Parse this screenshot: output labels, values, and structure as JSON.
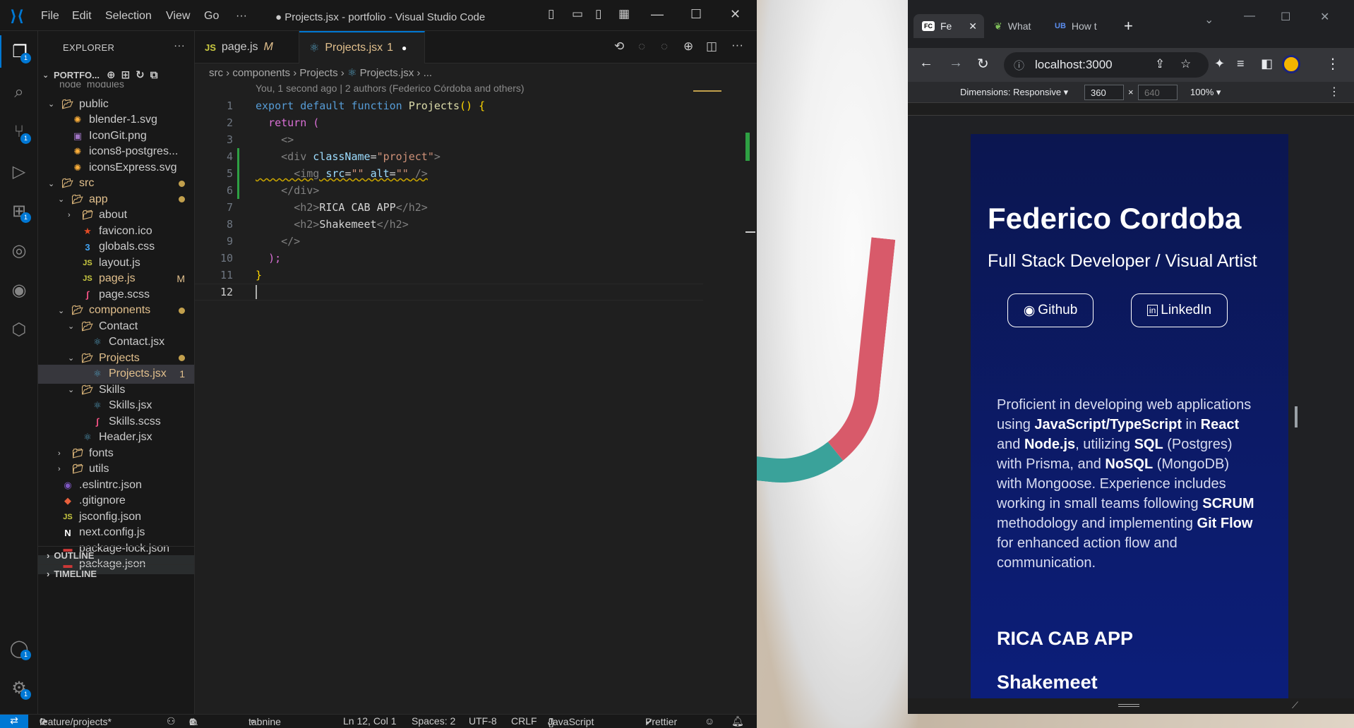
{
  "vscode": {
    "title": "● Projects.jsx - portfolio - Visual Studio Code",
    "menu": [
      "File",
      "Edit",
      "Selection",
      "View",
      "Go",
      "···"
    ],
    "explorer_title": "EXPLORER",
    "explorer_more": "···",
    "project_name": "PORTFO...",
    "partial_top": "node_modules",
    "tree": [
      {
        "label": "public",
        "type": "folder-open",
        "depth": 1
      },
      {
        "label": "blender-1.svg",
        "type": "svg",
        "depth": 2
      },
      {
        "label": "IconGit.png",
        "type": "png",
        "depth": 2
      },
      {
        "label": "icons8-postgres...",
        "type": "svg",
        "depth": 2
      },
      {
        "label": "iconsExpress.svg",
        "type": "svg",
        "depth": 2
      },
      {
        "label": "src",
        "type": "folder-open",
        "depth": 1,
        "dot": true
      },
      {
        "label": "app",
        "type": "folder-open",
        "depth": 2,
        "dot": true
      },
      {
        "label": "about",
        "type": "folder-closed",
        "depth": 3
      },
      {
        "label": "favicon.ico",
        "type": "ico",
        "depth": 3
      },
      {
        "label": "globals.css",
        "type": "css",
        "depth": 3
      },
      {
        "label": "layout.js",
        "type": "js",
        "depth": 3
      },
      {
        "label": "page.js",
        "type": "js",
        "depth": 3,
        "status": "M"
      },
      {
        "label": "page.scss",
        "type": "scss",
        "depth": 3
      },
      {
        "label": "components",
        "type": "folder-open",
        "depth": 2,
        "dot": true
      },
      {
        "label": "Contact",
        "type": "folder-open",
        "depth": 3
      },
      {
        "label": "Contact.jsx",
        "type": "react",
        "depth": 4
      },
      {
        "label": "Projects",
        "type": "folder-open",
        "depth": 3,
        "dot": true
      },
      {
        "label": "Projects.jsx",
        "type": "react",
        "depth": 4,
        "status": "1",
        "selected": true
      },
      {
        "label": "Skills",
        "type": "folder-open",
        "depth": 3
      },
      {
        "label": "Skills.jsx",
        "type": "react",
        "depth": 4
      },
      {
        "label": "Skills.scss",
        "type": "scss",
        "depth": 4
      },
      {
        "label": "Header.jsx",
        "type": "react",
        "depth": 3
      },
      {
        "label": "fonts",
        "type": "folder-closed",
        "depth": 2
      },
      {
        "label": "utils",
        "type": "folder-closed",
        "depth": 2
      },
      {
        "label": ".eslintrc.json",
        "type": "eslint",
        "depth": 1
      },
      {
        "label": ".gitignore",
        "type": "git",
        "depth": 1
      },
      {
        "label": "jsconfig.json",
        "type": "js",
        "depth": 1
      },
      {
        "label": "next.config.js",
        "type": "next",
        "depth": 1
      },
      {
        "label": "package-lock.json",
        "type": "npm",
        "depth": 1
      },
      {
        "label": "package.json",
        "type": "npm",
        "depth": 1,
        "hover": true
      }
    ],
    "outline_label": "OUTLINE",
    "timeline_label": "TIMELINE",
    "tabs": [
      {
        "label": "page.js",
        "prefix": "JS",
        "status": "M"
      },
      {
        "label": "Projects.jsx",
        "status": "1"
      }
    ],
    "breadcrumb": [
      "src",
      "components",
      "Projects",
      "Projects.jsx",
      "..."
    ],
    "blame": "You, 1 second ago | 2 authors (Federico Córdoba and others)",
    "line_numbers": [
      "1",
      "2",
      "3",
      "4",
      "5",
      "6",
      "7",
      "8",
      "9",
      "10",
      "11",
      "12"
    ],
    "code": {
      "l1": [
        "export",
        "default",
        "function",
        "Projects",
        "() {"
      ],
      "l2": [
        "return",
        "("
      ],
      "l3": "<>",
      "l4": [
        "<div",
        "className",
        "=",
        "\"project\"",
        ">"
      ],
      "l5": [
        "<img",
        "src",
        "=",
        "\"\"",
        "alt",
        "=",
        "\"\"",
        "/>"
      ],
      "l6": "</div>",
      "l7": [
        "<h2>",
        "RICA CAB APP",
        "</h2>"
      ],
      "l8": [
        "<h2>",
        "Shakemeet",
        "</h2>"
      ],
      "l9": "</>",
      "l10": ");",
      "l11": "}"
    },
    "status": {
      "branch": "feature/projects*",
      "errors": "0",
      "warnings": "1",
      "tabnine": "tabnine starter",
      "position": "Ln 12, Col 1",
      "spaces": "Spaces: 2",
      "encoding": "UTF-8",
      "eol": "CRLF",
      "language": "JavaScript JSX",
      "formatter": "Prettier"
    },
    "badges": {
      "explorer": "1",
      "scm": "1",
      "extensions": "1",
      "accounts": "1",
      "settings": "1"
    }
  },
  "browser": {
    "tabs": [
      {
        "label": "Fe",
        "icon": "FC",
        "active": true
      },
      {
        "label": "What",
        "icon": "leaf"
      },
      {
        "label": "How t",
        "icon": "UB"
      }
    ],
    "url": "localhost:3000",
    "devtools": {
      "dimensions": "Dimensions: Responsive ▾",
      "width": "360",
      "x": "×",
      "height": "640",
      "zoom": "100% ▾"
    },
    "page": {
      "name": "Federico Cordoba",
      "subtitle": "Full Stack Developer / Visual Artist",
      "github": "Github",
      "linkedin": "LinkedIn",
      "bio": [
        {
          "t": "Proficient in developing web applications using ",
          "b": false
        },
        {
          "t": "JavaScript/TypeScript",
          "b": true
        },
        {
          "t": " in ",
          "b": false
        },
        {
          "t": "React",
          "b": true
        },
        {
          "t": " and ",
          "b": false
        },
        {
          "t": "Node.js",
          "b": true
        },
        {
          "t": ", utilizing ",
          "b": false
        },
        {
          "t": "SQL",
          "b": true
        },
        {
          "t": " (Postgres) with Prisma, and ",
          "b": false
        },
        {
          "t": "NoSQL",
          "b": true
        },
        {
          "t": " (MongoDB) with Mongoose. Experience includes working in small teams following ",
          "b": false
        },
        {
          "t": "SCRUM",
          "b": true
        },
        {
          "t": " methodology and implementing ",
          "b": false
        },
        {
          "t": "Git Flow",
          "b": true
        },
        {
          "t": " for enhanced action flow and communication.",
          "b": false
        }
      ],
      "project1": "RICA CAB APP",
      "project2": "Shakemeet"
    }
  }
}
